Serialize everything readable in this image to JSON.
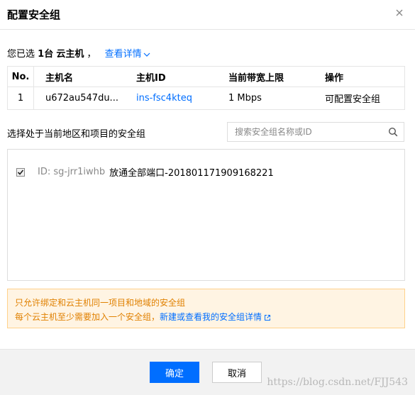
{
  "dialog": {
    "title": "配置安全组"
  },
  "selection": {
    "prefix": "您已选",
    "count": "1台",
    "unit": "云主机",
    "separator": "，",
    "details_link": "查看详情"
  },
  "hosts_table": {
    "headers": [
      "No.",
      "主机名",
      "主机ID",
      "当前带宽上限",
      "操作"
    ],
    "rows": [
      {
        "no": "1",
        "name": "u672au547du...",
        "id": "ins-fsc4kteq",
        "bandwidth": "1 Mbps",
        "action": "可配置安全组"
      }
    ]
  },
  "security_groups": {
    "label": "选择处于当前地区和项目的安全组",
    "search_placeholder": "搜索安全组名称或ID",
    "items": [
      {
        "id_label": "ID: sg-jrr1iwhb",
        "name": "放通全部端口-20180117190916822​1",
        "checked": true
      }
    ]
  },
  "notice": {
    "line1": "只允许绑定和云主机同一项目和地域的安全组",
    "line2_text": "每个云主机至少需要加入一个安全组，",
    "line2_link": "新建或查看我的安全组详情"
  },
  "footer": {
    "ok_label": "确定",
    "cancel_label": "取消"
  },
  "watermark": "https://blog.csdn.net/FJJ543",
  "colors": {
    "accent": "#006eff",
    "notice_bg": "#fff4e3",
    "notice_text": "#e08000"
  }
}
